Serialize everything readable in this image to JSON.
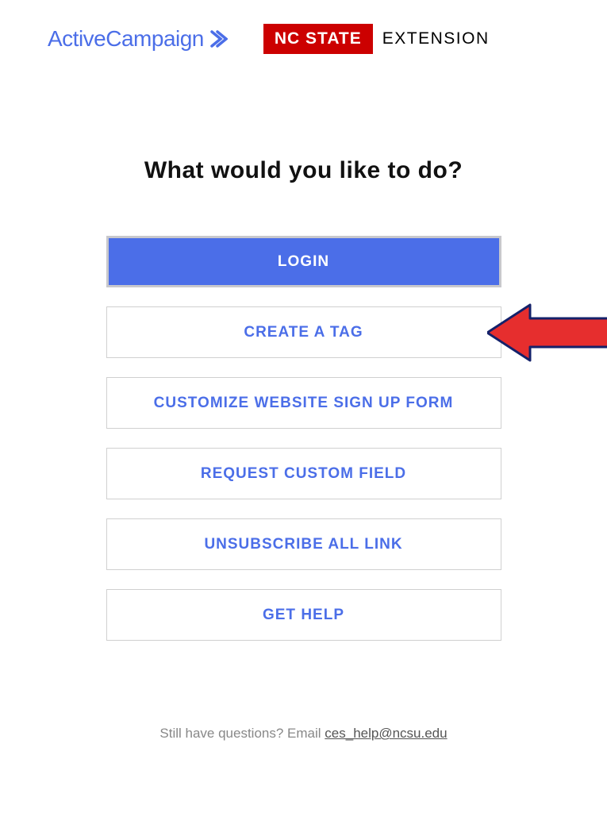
{
  "header": {
    "activecampaign_text": "ActiveCampaign",
    "nc_state_badge": "NC STATE",
    "nc_extension": "EXTENSION"
  },
  "main": {
    "heading": "What would you like to do?",
    "buttons": {
      "login": "LOGIN",
      "create_tag": "CREATE A TAG",
      "customize_form": "CUSTOMIZE WEBSITE SIGN UP FORM",
      "request_field": "REQUEST CUSTOM FIELD",
      "unsubscribe": "UNSUBSCRIBE ALL LINK",
      "get_help": "GET HELP"
    }
  },
  "footer": {
    "prefix": "Still have questions? Email ",
    "email": "ces_help@ncsu.edu"
  }
}
